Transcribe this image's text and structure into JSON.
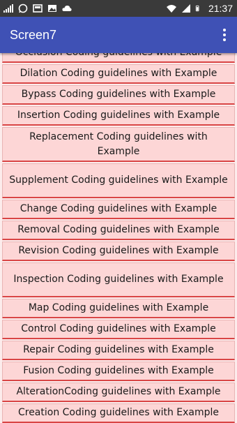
{
  "status_bar": {
    "time": "21:37",
    "left_icons": [
      "signal-bars-icon",
      "whatsapp-icon",
      "gallery-icon",
      "image-icon",
      "cloud-icon"
    ],
    "right_icons": [
      "wifi-icon",
      "sim-signal-icon",
      "battery-icon"
    ]
  },
  "app_bar": {
    "title": "Screen7",
    "menu_icon": "overflow-menu-icon"
  },
  "list": {
    "partial_top_item": "Occlusion Coding guidelines with Example",
    "items": [
      {
        "label": "Dilation Coding guidelines with Example"
      },
      {
        "label": "Bypass Coding guidelines with Example"
      },
      {
        "label": "Insertion Coding guidelines with Example"
      },
      {
        "label": "Replacement Coding guidelines with Example"
      },
      {
        "label": "Supplement Coding guidelines with Example"
      },
      {
        "label": "Change Coding guidelines with Example"
      },
      {
        "label": "Removal Coding guidelines with Example"
      },
      {
        "label": "Revision Coding guidelines with Example"
      },
      {
        "label": "Inspection Coding guidelines with Example"
      },
      {
        "label": "Map Coding guidelines with Example"
      },
      {
        "label": "Control Coding guidelines with Example"
      },
      {
        "label": "Repair Coding guidelines with Example"
      },
      {
        "label": "Fusion Coding guidelines with Example"
      },
      {
        "label": "AlterationCoding guidelines with Example"
      },
      {
        "label": "Creation Coding guidelines with Example"
      }
    ]
  },
  "colors": {
    "app_bar": "#3f51b5",
    "status_bar": "#3a3a3a",
    "item_background": "#fdd6d6",
    "item_underline": "#d94545"
  }
}
